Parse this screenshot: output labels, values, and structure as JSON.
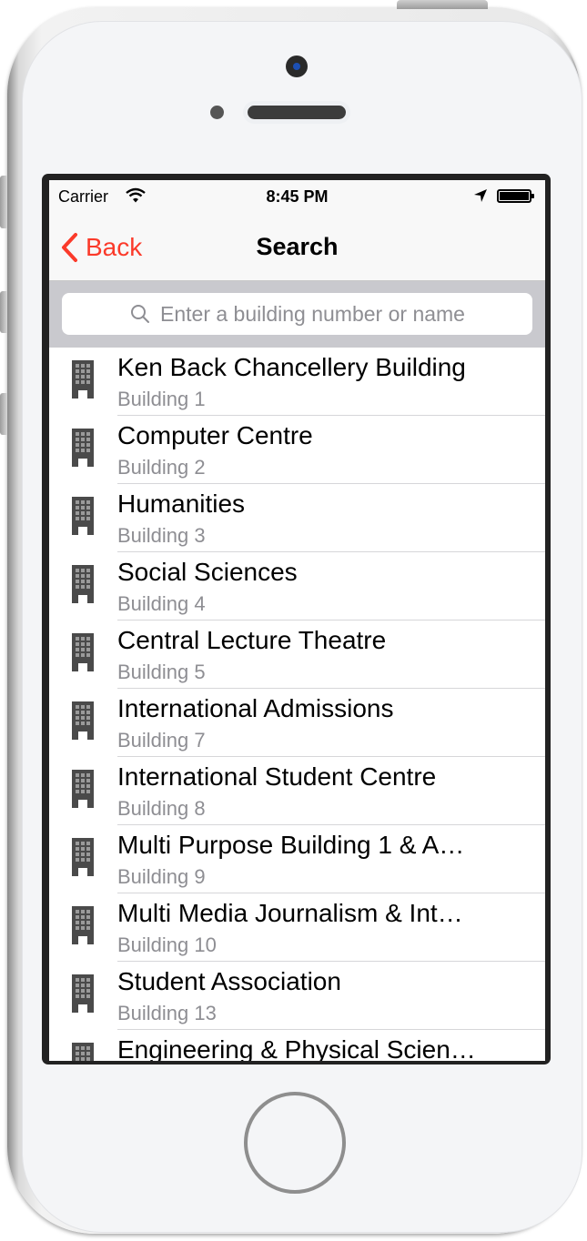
{
  "status_bar": {
    "carrier": "Carrier",
    "time": "8:45 PM",
    "icons": [
      "wifi-icon",
      "location-arrow-icon",
      "battery-icon"
    ],
    "battery_level": 1.0
  },
  "nav_bar": {
    "back_label": "Back",
    "title": "Search",
    "accent_color": "#fb3a2a"
  },
  "search": {
    "placeholder": "Enter a building number or name",
    "value": "",
    "icon": "search-icon"
  },
  "buildings": [
    {
      "name": "Ken Back Chancellery Building",
      "number": "Building 1",
      "icon": "building-icon"
    },
    {
      "name": "Computer Centre",
      "number": "Building 2",
      "icon": "building-icon"
    },
    {
      "name": "Humanities",
      "number": "Building 3",
      "icon": "building-icon"
    },
    {
      "name": "Social Sciences",
      "number": "Building 4",
      "icon": "building-icon"
    },
    {
      "name": "Central Lecture Theatre",
      "number": "Building 5",
      "icon": "building-icon"
    },
    {
      "name": "International Admissions",
      "number": "Building 7",
      "icon": "building-icon"
    },
    {
      "name": "International Student Centre",
      "number": "Building 8",
      "icon": "building-icon"
    },
    {
      "name": "Multi Purpose Building 1 & A…",
      "number": "Building 9",
      "icon": "building-icon"
    },
    {
      "name": "Multi Media Journalism & Int…",
      "number": "Building 10",
      "icon": "building-icon"
    },
    {
      "name": "Student Association",
      "number": "Building 13",
      "icon": "building-icon"
    },
    {
      "name": "Engineering & Physical Scien…",
      "number": "",
      "icon": "building-icon"
    }
  ]
}
